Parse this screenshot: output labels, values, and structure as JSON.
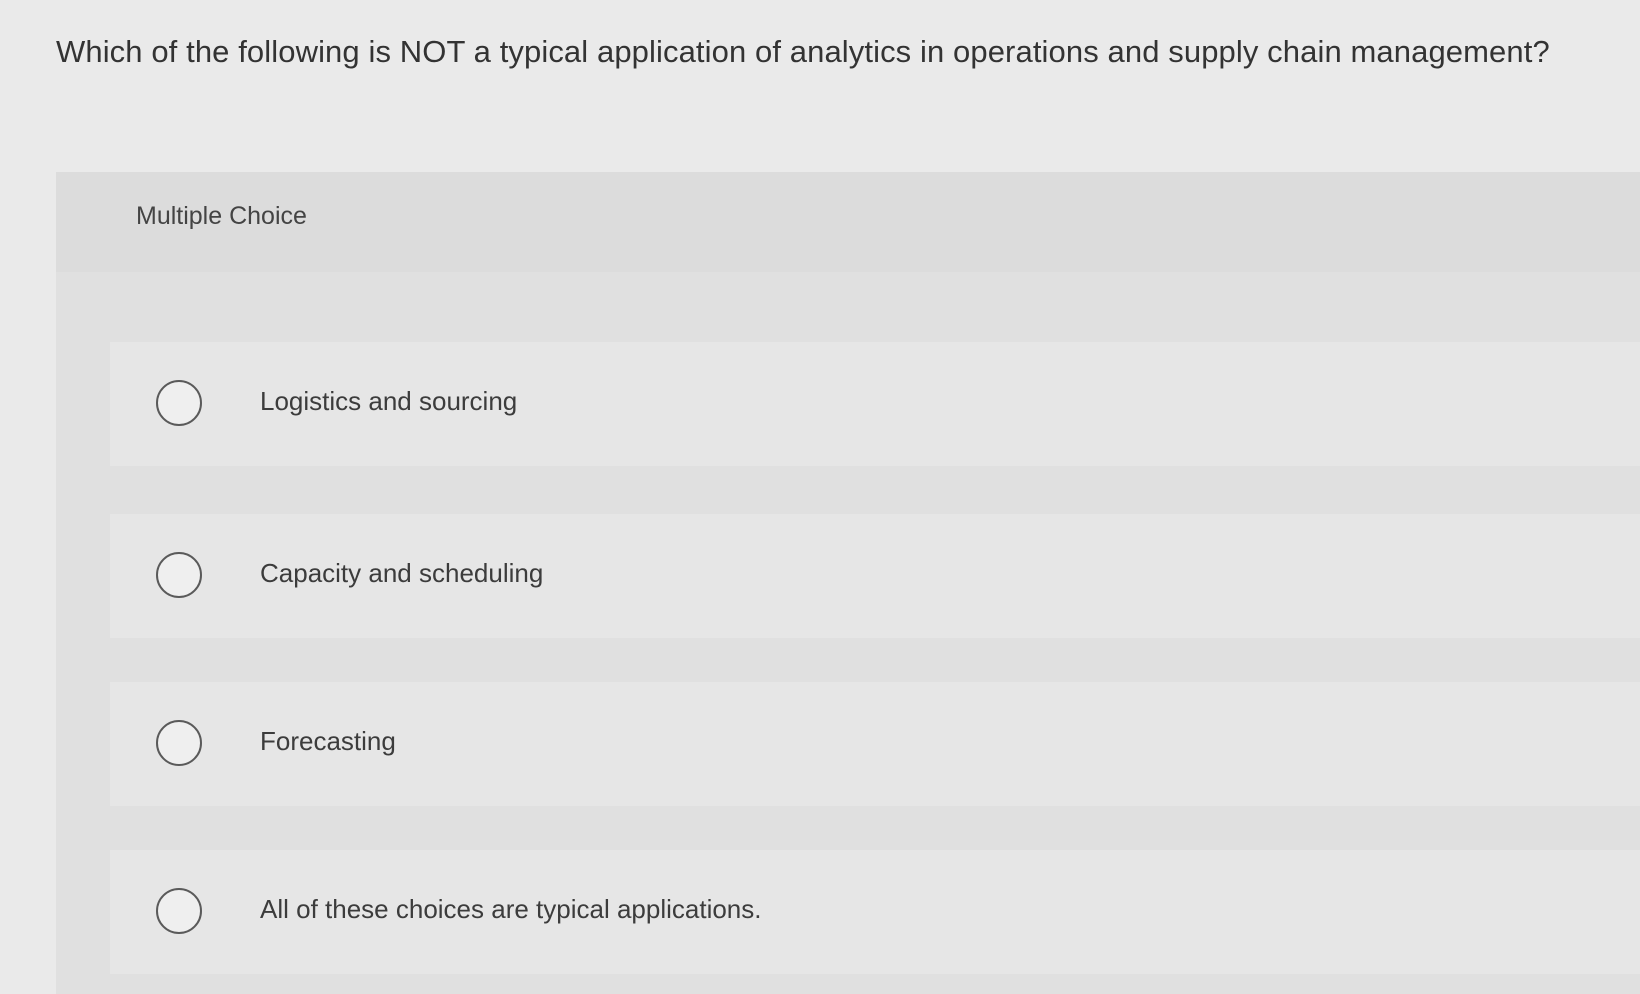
{
  "question": {
    "text": "Which of the following is NOT a typical application of analytics in operations and supply chain management?"
  },
  "panel": {
    "type_label": "Multiple Choice"
  },
  "options": [
    {
      "label": "Logistics and sourcing",
      "selected": false
    },
    {
      "label": "Capacity and scheduling",
      "selected": false
    },
    {
      "label": "Forecasting",
      "selected": false
    },
    {
      "label": "All of these choices are typical applications.",
      "selected": false
    }
  ]
}
